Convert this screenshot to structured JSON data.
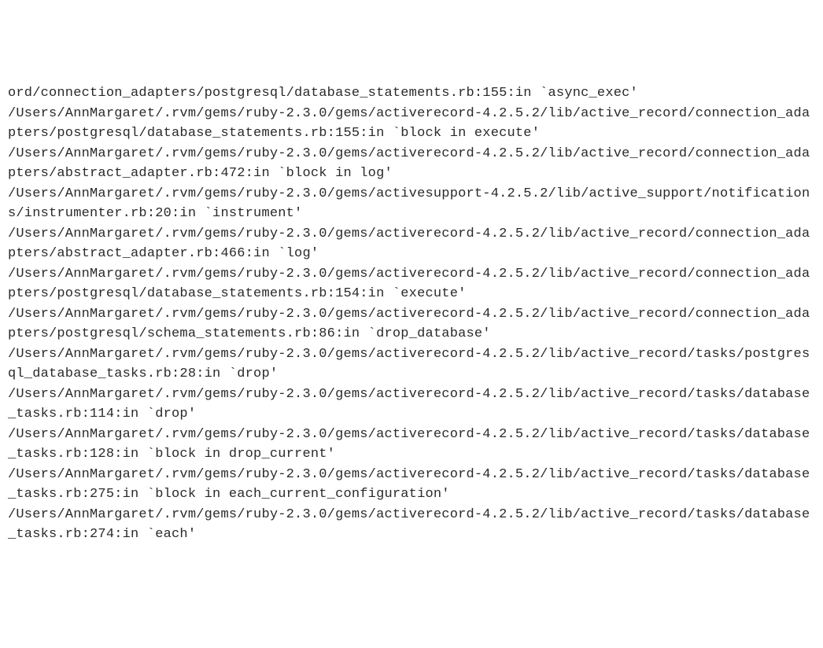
{
  "stacktrace": {
    "lines": [
      "ord/connection_adapters/postgresql/database_statements.rb:155:in `async_exec'",
      "/Users/AnnMargaret/.rvm/gems/ruby-2.3.0/gems/activerecord-4.2.5.2/lib/active_record/connection_adapters/postgresql/database_statements.rb:155:in `block in execute'",
      "/Users/AnnMargaret/.rvm/gems/ruby-2.3.0/gems/activerecord-4.2.5.2/lib/active_record/connection_adapters/abstract_adapter.rb:472:in `block in log'",
      "/Users/AnnMargaret/.rvm/gems/ruby-2.3.0/gems/activesupport-4.2.5.2/lib/active_support/notifications/instrumenter.rb:20:in `instrument'",
      "/Users/AnnMargaret/.rvm/gems/ruby-2.3.0/gems/activerecord-4.2.5.2/lib/active_record/connection_adapters/abstract_adapter.rb:466:in `log'",
      "/Users/AnnMargaret/.rvm/gems/ruby-2.3.0/gems/activerecord-4.2.5.2/lib/active_record/connection_adapters/postgresql/database_statements.rb:154:in `execute'",
      "/Users/AnnMargaret/.rvm/gems/ruby-2.3.0/gems/activerecord-4.2.5.2/lib/active_record/connection_adapters/postgresql/schema_statements.rb:86:in `drop_database'",
      "/Users/AnnMargaret/.rvm/gems/ruby-2.3.0/gems/activerecord-4.2.5.2/lib/active_record/tasks/postgresql_database_tasks.rb:28:in `drop'",
      "/Users/AnnMargaret/.rvm/gems/ruby-2.3.0/gems/activerecord-4.2.5.2/lib/active_record/tasks/database_tasks.rb:114:in `drop'",
      "/Users/AnnMargaret/.rvm/gems/ruby-2.3.0/gems/activerecord-4.2.5.2/lib/active_record/tasks/database_tasks.rb:128:in `block in drop_current'",
      "/Users/AnnMargaret/.rvm/gems/ruby-2.3.0/gems/activerecord-4.2.5.2/lib/active_record/tasks/database_tasks.rb:275:in `block in each_current_configuration'",
      "/Users/AnnMargaret/.rvm/gems/ruby-2.3.0/gems/activerecord-4.2.5.2/lib/active_record/tasks/database_tasks.rb:274:in `each'"
    ]
  }
}
